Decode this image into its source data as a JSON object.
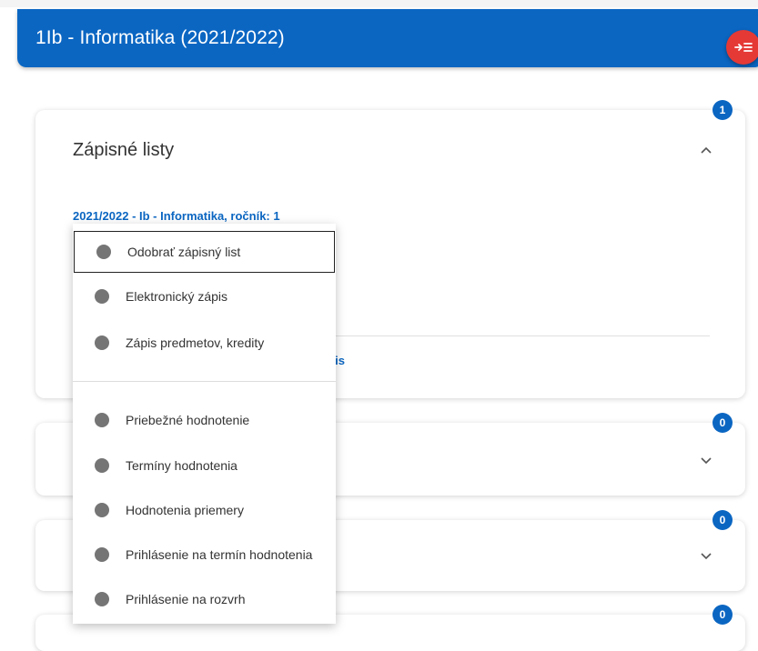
{
  "header": {
    "title": "1Ib - Informatika (2021/2022)",
    "fab_icon": "collapse-menu-icon",
    "fab_color": "#e53935"
  },
  "colors": {
    "primary": "#0b66c2",
    "accent": "#e53935"
  },
  "cards": [
    {
      "title": "Zápisné listy",
      "badge": "1",
      "expanded": true
    },
    {
      "badge": "0",
      "expanded": false
    },
    {
      "badge": "0",
      "expanded": false
    },
    {
      "badge": "0",
      "expanded": false
    }
  ],
  "enrollment": {
    "link": "2021/2022 - Ib - Informatika, ročník: 1",
    "bottom_link_fragment": "ápis"
  },
  "menu": {
    "items": [
      {
        "label": "Odobrať zápisný list"
      },
      {
        "label": "Elektronický zápis"
      },
      {
        "label": "Zápis predmetov, kredity"
      },
      {
        "label": "Priebežné hodnotenie"
      },
      {
        "label": "Termíny hodnotenia"
      },
      {
        "label": "Hodnotenia priemery"
      },
      {
        "label": "Prihlásenie na termín hodnotenia"
      },
      {
        "label": "Prihlásenie na rozvrh"
      }
    ]
  }
}
